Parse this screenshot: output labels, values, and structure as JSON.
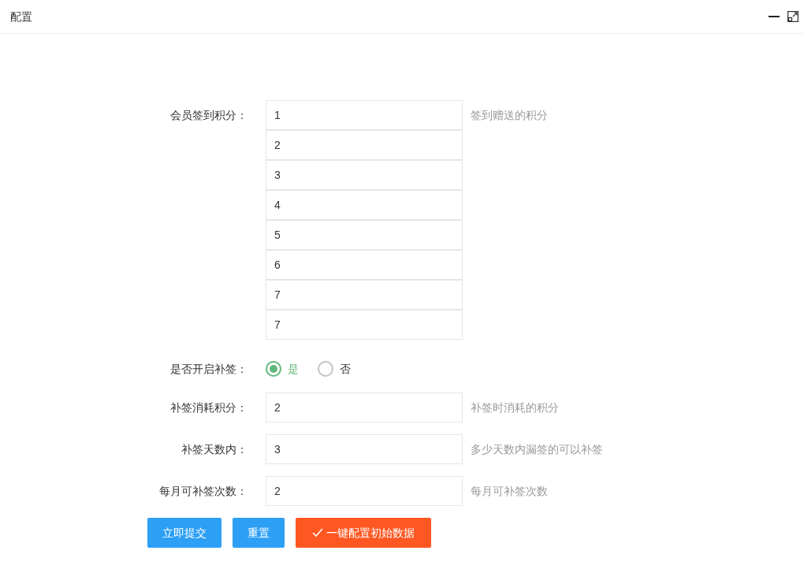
{
  "window": {
    "title": "配置"
  },
  "signin_points": {
    "label": "会员签到积分：",
    "hint": "签到赠送的积分",
    "values": [
      "1",
      "2",
      "3",
      "4",
      "5",
      "6",
      "7",
      "7"
    ]
  },
  "makeup_enabled": {
    "label": "是否开启补签：",
    "options": [
      {
        "label": "是",
        "selected": true
      },
      {
        "label": "否",
        "selected": false
      }
    ]
  },
  "fields": [
    {
      "label": "补签消耗积分：",
      "value": "2",
      "hint": "补签时消耗的积分"
    },
    {
      "label": "补签天数内：",
      "value": "3",
      "hint": "多少天数内漏签的可以补签"
    },
    {
      "label": "每月可补签次数：",
      "value": "2",
      "hint": "每月可补签次数"
    }
  ],
  "buttons": [
    {
      "label": "立即提交",
      "kind": "primary"
    },
    {
      "label": "重置",
      "kind": "primary"
    },
    {
      "label": "一键配置初始数据",
      "kind": "warm"
    }
  ]
}
